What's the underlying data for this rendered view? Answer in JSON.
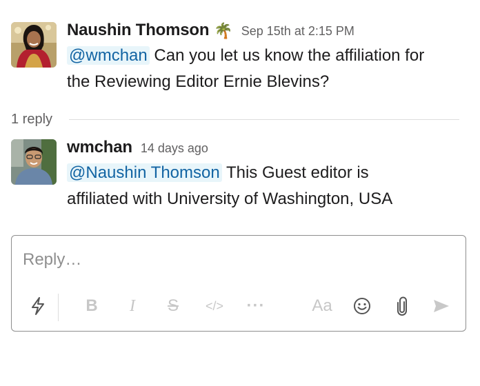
{
  "messages": [
    {
      "author": "Naushin Thomson",
      "status_emoji": "🌴",
      "timestamp": "Sep 15th at 2:15 PM",
      "mention": "@wmchan",
      "text_line1": " Can you let us know the affiliation for",
      "text_line2": "the Reviewing Editor Ernie Blevins?"
    },
    {
      "author": "wmchan",
      "timestamp": "14 days ago",
      "mention": "@Naushin Thomson",
      "text_line1": " This Guest editor is",
      "text_line2": "affiliated with University of Washington, USA"
    }
  ],
  "thread": {
    "reply_count": "1 reply"
  },
  "composer": {
    "placeholder": "Reply…",
    "value": "",
    "toolbar": {
      "shortcuts_icon": "lightning-icon",
      "bold_label": "B",
      "italic_label": "I",
      "strike_label": "S",
      "code_label": "</>",
      "more_label": "···",
      "format_label": "Aa",
      "emoji_icon": "smiley-icon",
      "attach_icon": "paperclip-icon",
      "send_icon": "send-icon"
    }
  },
  "colors": {
    "mention": "#1264a3",
    "mention_bg": "#e8f5fa",
    "muted": "#616061",
    "border": "#8d8d8d"
  }
}
